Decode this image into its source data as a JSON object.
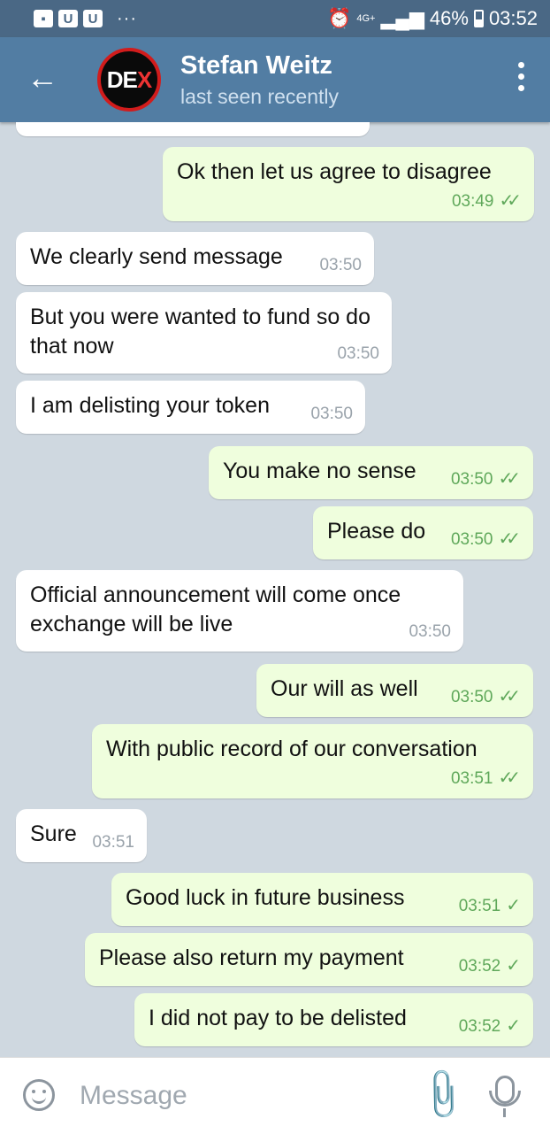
{
  "status_bar": {
    "battery": "46%",
    "time": "03:52",
    "network": "4G+",
    "left_icons": [
      "image-icon",
      "u-icon",
      "u-icon"
    ],
    "dots": "···"
  },
  "header": {
    "back_icon": "←",
    "avatar_text": "DE",
    "avatar_accent": "X",
    "contact_name": "Stefan Weitz",
    "contact_status": "last seen recently"
  },
  "messages": [
    {
      "dir": "out",
      "text": "Ok then let us agree to disagree",
      "time": "03:49",
      "ticks": "✓✓"
    },
    {
      "dir": "in",
      "text": "We clearly send message",
      "time": "03:50"
    },
    {
      "dir": "in",
      "text": "But you were wanted to fund so do that now",
      "time": "03:50"
    },
    {
      "dir": "in",
      "text": "I am delisting your token",
      "time": "03:50"
    },
    {
      "dir": "out",
      "text": "You make no sense",
      "time": "03:50",
      "ticks": "✓✓"
    },
    {
      "dir": "out",
      "text": "Please do",
      "time": "03:50",
      "ticks": "✓✓"
    },
    {
      "dir": "in",
      "text": "Official announcement will come once exchange will be live",
      "time": "03:50"
    },
    {
      "dir": "out",
      "text": "Our will as well",
      "time": "03:50",
      "ticks": "✓✓"
    },
    {
      "dir": "out",
      "text": "With public record of our conversation",
      "time": "03:51",
      "ticks": "✓✓"
    },
    {
      "dir": "in",
      "text": "Sure",
      "time": "03:51"
    },
    {
      "dir": "out",
      "text": "Good luck in future business",
      "time": "03:51",
      "ticks": "✓"
    },
    {
      "dir": "out",
      "text": "Please also return my payment",
      "time": "03:52",
      "ticks": "✓"
    },
    {
      "dir": "out",
      "text": "I did not pay to be delisted",
      "time": "03:52",
      "ticks": "✓"
    }
  ],
  "input": {
    "placeholder": "Message"
  },
  "colors": {
    "header": "#527da3",
    "status_bar": "#4a6885",
    "outgoing_bubble": "#effedd",
    "incoming_bubble": "#ffffff",
    "chat_background": "#cfd8e0"
  }
}
